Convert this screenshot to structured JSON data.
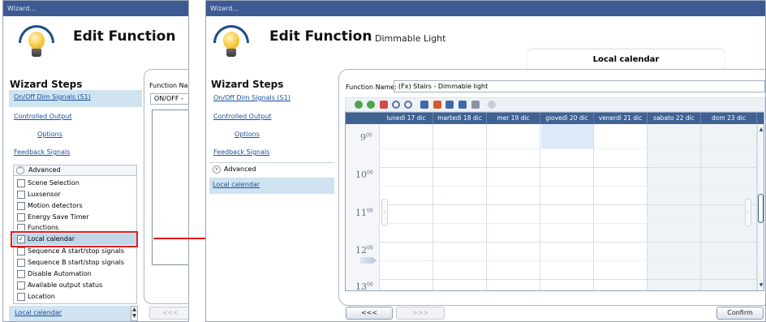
{
  "left_window": {
    "titlebar": "Wizard...",
    "header_title": "Edit Function",
    "wizard_steps_title": "Wizard Steps",
    "steps": [
      {
        "label": "On/Off Dim Signals (S1)"
      },
      {
        "label": "Controlled Output"
      },
      {
        "label": "Options"
      },
      {
        "label": "Feedback Signals"
      }
    ],
    "advanced_label": "Advanced",
    "advanced_items": [
      {
        "label": "Scene Selection",
        "checked": false
      },
      {
        "label": "Luxsensor",
        "checked": false
      },
      {
        "label": "Motion detectors",
        "checked": false
      },
      {
        "label": "Energy Save Timer",
        "checked": false
      },
      {
        "label": "Functions",
        "checked": false
      },
      {
        "label": "Local calendar",
        "checked": true
      },
      {
        "label": "Sequence A start/stop signals",
        "checked": false
      },
      {
        "label": "Sequence B start/stop signals",
        "checked": false
      },
      {
        "label": "Disable Automation",
        "checked": false
      },
      {
        "label": "Available output status",
        "checked": false
      },
      {
        "label": "Location",
        "checked": false
      }
    ],
    "bottom_link": "Local calendar",
    "function_name_label": "Function Nar",
    "function_select_value": "ON/OFF -",
    "back_button": "<<<"
  },
  "right_window": {
    "titlebar": "Wizard...",
    "header_title": "Edit Function",
    "header_subtitle": "Dimmable Light",
    "section_tab": "Local calendar",
    "wizard_steps_title": "Wizard Steps",
    "steps": [
      {
        "label": "On/Off Dim Signals (S1)"
      },
      {
        "label": "Controlled Output"
      },
      {
        "label": "Options"
      },
      {
        "label": "Feedback Signals"
      }
    ],
    "advanced_label": "Advanced",
    "advanced_link": "Local calendar",
    "function_name_label": "Function Name:",
    "function_name_value": "(Fx) Stairs - Dimmable light",
    "calendar": {
      "days": [
        "lunedì 17 dic",
        "martedì 18 dic",
        "mer 19 dic",
        "giovedì 20 dic",
        "venerdì 21 dic",
        "sabato 22 dic",
        "dom 23 dic"
      ],
      "hours": [
        {
          "h": "9",
          "m": "00"
        },
        {
          "h": "10",
          "m": "00"
        },
        {
          "h": "11",
          "m": "00"
        },
        {
          "h": "12",
          "m": "00"
        },
        {
          "h": "13",
          "m": "00"
        }
      ]
    },
    "back_button": "<<<",
    "next_button": ">>>",
    "confirm_button": "Confirm"
  },
  "colors": {
    "titlebar": "#3d5a93",
    "link": "#1a4f9c",
    "highlight": "#cfe3f1",
    "callout_red": "#e21b1b",
    "calendar_header": "#3f6194"
  }
}
